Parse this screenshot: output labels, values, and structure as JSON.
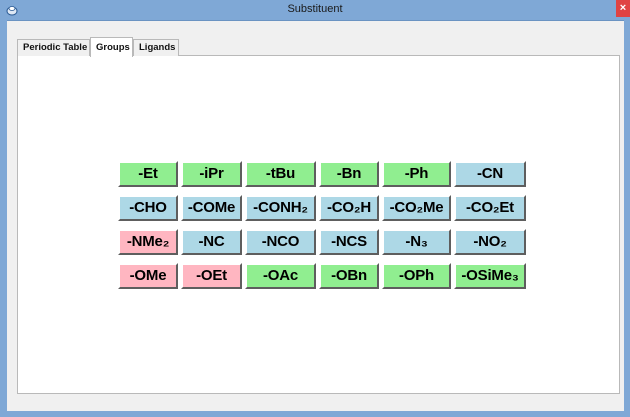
{
  "window": {
    "title": "Substituent",
    "close_glyph": "×",
    "icon": "app-icon"
  },
  "tabs": [
    {
      "label": "Periodic Table",
      "active": false
    },
    {
      "label": "Groups",
      "active": true
    },
    {
      "label": "Ligands",
      "active": false
    }
  ],
  "colors": {
    "green": "#90ee90",
    "blue": "#add8e6",
    "pink": "#ffb6c1",
    "titlebar": "#7fa8d6",
    "close": "#e04343"
  },
  "groups": [
    [
      {
        "label": "-Et",
        "color": "green"
      },
      {
        "label": "-iPr",
        "color": "green"
      },
      {
        "label": "-tBu",
        "color": "green"
      },
      {
        "label": "-Bn",
        "color": "green"
      },
      {
        "label": "-Ph",
        "color": "green"
      },
      {
        "label": "-CN",
        "color": "blue"
      }
    ],
    [
      {
        "label": "-CHO",
        "color": "blue"
      },
      {
        "label": "-COMe",
        "color": "blue"
      },
      {
        "label": "-CONH₂",
        "color": "blue"
      },
      {
        "label": "-CO₂H",
        "color": "blue"
      },
      {
        "label": "-CO₂Me",
        "color": "blue"
      },
      {
        "label": "-CO₂Et",
        "color": "blue"
      }
    ],
    [
      {
        "label": "-NMe₂",
        "color": "pink"
      },
      {
        "label": "-NC",
        "color": "blue"
      },
      {
        "label": "-NCO",
        "color": "blue"
      },
      {
        "label": "-NCS",
        "color": "blue"
      },
      {
        "label": "-N₃",
        "color": "blue"
      },
      {
        "label": "-NO₂",
        "color": "blue"
      }
    ],
    [
      {
        "label": "-OMe",
        "color": "pink"
      },
      {
        "label": "-OEt",
        "color": "pink"
      },
      {
        "label": "-OAc",
        "color": "green"
      },
      {
        "label": "-OBn",
        "color": "green"
      },
      {
        "label": "-OPh",
        "color": "green"
      },
      {
        "label": "-OSiMe₃",
        "color": "green"
      }
    ]
  ]
}
